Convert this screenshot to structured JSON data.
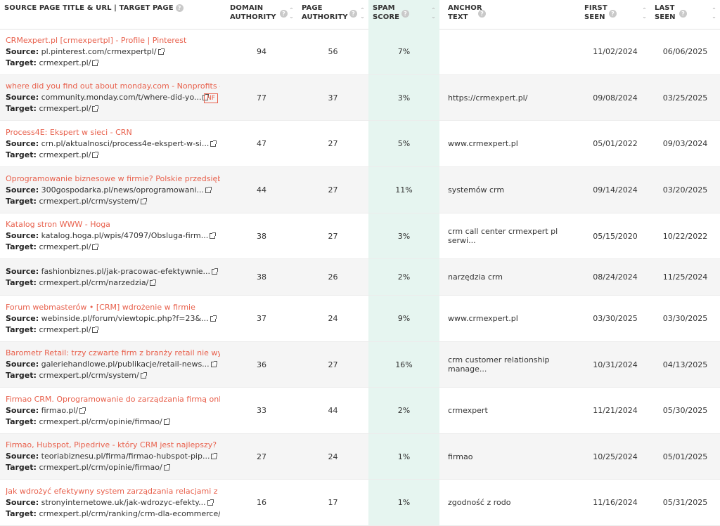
{
  "headers": {
    "source": "SOURCE PAGE TITLE & URL | TARGET PAGE",
    "domain_authority": [
      "DOMAIN",
      "AUTHORITY"
    ],
    "page_authority": [
      "PAGE",
      "AUTHORITY"
    ],
    "spam_score": [
      "SPAM",
      "SCORE"
    ],
    "anchor_text": [
      "ANCHOR",
      "TEXT"
    ],
    "first_seen": [
      "FIRST",
      "SEEN"
    ],
    "last_seen": [
      "LAST",
      "SEEN"
    ]
  },
  "labels": {
    "source": "Source:",
    "target": "Target:",
    "nofollow": "NF"
  },
  "icons": {
    "help": "question-circle-icon",
    "sort": "sort-icon",
    "external": "external-link-icon"
  },
  "colors": {
    "link": "#e8604c",
    "spam_bg": "#e6f5f0",
    "row_alt": "#f5f5f5"
  },
  "rows": [
    {
      "title": "CRMexpert.pl [crmexpertpl] - Profile | Pinterest",
      "source": "pl.pinterest.com/crmexpertpl/",
      "target": "crmexpert.pl/",
      "da": "94",
      "pa": "56",
      "spam": "7%",
      "anchor": "",
      "first": "11/02/2024",
      "last": "06/06/2025",
      "nf": false
    },
    {
      "title": "where did you find out about monday.com - Nonprofits - monday",
      "source": "community.monday.com/t/where-did-yo...",
      "target": "crmexpert.pl/",
      "da": "77",
      "pa": "37",
      "spam": "3%",
      "anchor": "https://crmexpert.pl/",
      "first": "09/08/2024",
      "last": "03/25/2025",
      "nf": true
    },
    {
      "title": "Process4E: Ekspert w sieci - CRN",
      "source": "crn.pl/aktualnosci/process4e-ekspert-w-si...",
      "target": "crmexpert.pl/",
      "da": "47",
      "pa": "27",
      "spam": "5%",
      "anchor": "www.crmexpert.pl",
      "first": "05/01/2022",
      "last": "09/03/2024",
      "nf": false
    },
    {
      "title": "Oprogramowanie biznesowe w firmie? Polskie przedsiębiorstwa",
      "source": "300gospodarka.pl/news/oprogramowani...",
      "target": "crmexpert.pl/crm/system/",
      "da": "44",
      "pa": "27",
      "spam": "11%",
      "anchor": "systemów crm",
      "first": "09/14/2024",
      "last": "03/20/2025",
      "nf": false
    },
    {
      "title": "Katalog stron WWW - Hoga",
      "source": "katalog.hoga.pl/wpis/47097/Obsluga-firm...",
      "target": "crmexpert.pl/",
      "da": "38",
      "pa": "27",
      "spam": "3%",
      "anchor": "crm call center crmexpert pl serwi...",
      "first": "05/15/2020",
      "last": "10/22/2022",
      "nf": false
    },
    {
      "title": "",
      "source": "fashionbiznes.pl/jak-pracowac-efektywnie...",
      "target": "crmexpert.pl/crm/narzedzia/",
      "da": "38",
      "pa": "26",
      "spam": "2%",
      "anchor": "narzędzia crm",
      "first": "08/24/2024",
      "last": "11/25/2024",
      "nf": false
    },
    {
      "title": "Forum webmasterów • [CRM] wdrożenie w firmie",
      "source": "webinside.pl/forum/viewtopic.php?f=23&...",
      "target": "crmexpert.pl/",
      "da": "37",
      "pa": "24",
      "spam": "9%",
      "anchor": "www.crmexpert.pl",
      "first": "03/30/2025",
      "last": "03/30/2025",
      "nf": false
    },
    {
      "title": "Barometr Retail: trzy czwarte firm z branży retail nie wykorzystuje",
      "source": "galeriehandlowe.pl/publikacje/retail-news...",
      "target": "crmexpert.pl/crm/system/",
      "da": "36",
      "pa": "27",
      "spam": "16%",
      "anchor": "crm customer relationship manage...",
      "first": "10/31/2024",
      "last": "04/13/2025",
      "nf": false
    },
    {
      "title": "Firmao CRM. Oprogramowanie do zarządzania firmą online.",
      "source": "firmao.pl/",
      "target": "crmexpert.pl/crm/opinie/firmao/",
      "da": "33",
      "pa": "44",
      "spam": "2%",
      "anchor": "crmexpert",
      "first": "11/21/2024",
      "last": "05/30/2025",
      "nf": false
    },
    {
      "title": "Firmao, Hubspot, Pipedrive - który CRM jest najlepszy?",
      "source": "teoriabiznesu.pl/firma/firmao-hubspot-pip...",
      "target": "crmexpert.pl/crm/opinie/firmao/",
      "da": "27",
      "pa": "24",
      "spam": "1%",
      "anchor": "firmao",
      "first": "10/25/2024",
      "last": "05/01/2025",
      "nf": false
    },
    {
      "title": "Jak wdrożyć efektywny system zarządzania relacjami z klientami",
      "source": "stronyinternetowe.uk/jak-wdrozyc-efekty...",
      "target": "crmexpert.pl/crm/ranking/crm-dla-ecommerce/",
      "da": "16",
      "pa": "17",
      "spam": "1%",
      "anchor": "zgodność z rodo",
      "first": "11/16/2024",
      "last": "05/31/2025",
      "nf": false
    }
  ]
}
